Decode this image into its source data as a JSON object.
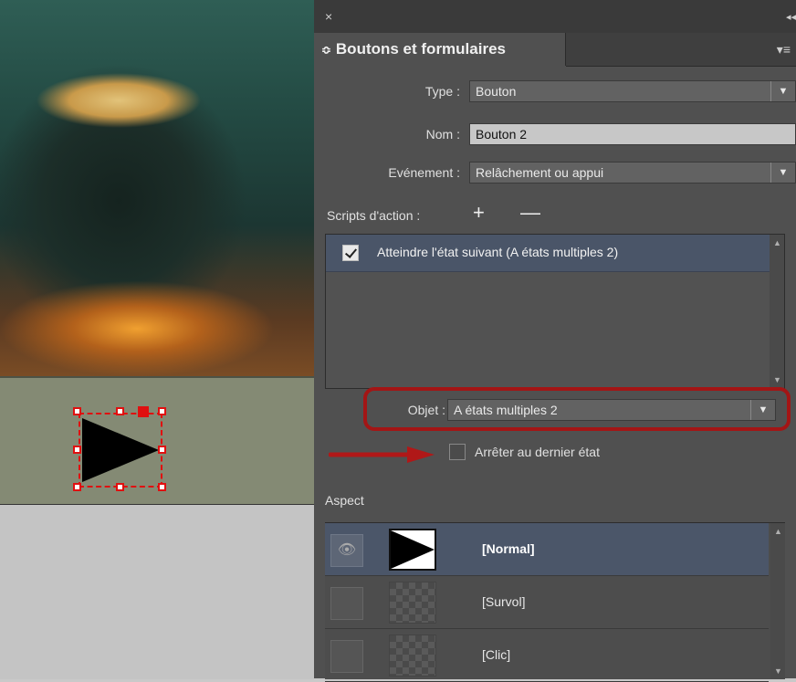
{
  "panel": {
    "title": "Boutons et formulaires",
    "close_glyph": "×",
    "collapse_glyph": "◂◂",
    "menu_glyph": "▾≡"
  },
  "form": {
    "type_label": "Type :",
    "type_value": "Bouton",
    "name_label": "Nom :",
    "name_value": "Bouton 2",
    "event_label": "Evénement :",
    "event_value": "Relâchement ou appui",
    "actions_label": "Scripts d'action :",
    "add_glyph": "+",
    "remove_glyph": "—"
  },
  "actions": [
    {
      "label": "Atteindre l'état suivant (A états multiples 2)",
      "checked": true
    }
  ],
  "object": {
    "label": "Objet :",
    "value": "A états multiples 2"
  },
  "stop_last": {
    "label": "Arrêter au dernier état",
    "checked": false
  },
  "aspect": {
    "label": "Aspect",
    "states": [
      {
        "name": "[Normal]",
        "active": true
      },
      {
        "name": "[Survol]",
        "active": false
      },
      {
        "name": "[Clic]",
        "active": false
      }
    ]
  },
  "colors": {
    "panel_bg": "#505050",
    "highlight_red": "#a31515",
    "selection_red": "#e01010",
    "active_row": "#4a5568"
  },
  "icons": [
    "close-icon",
    "collapse-icon",
    "panel-menu-icon",
    "add-icon",
    "remove-icon",
    "dropdown-arrow-icon",
    "eye-icon",
    "checkbox-icon",
    "scroll-arrow-icon",
    "play-triangle-icon",
    "red-arrow-icon"
  ]
}
